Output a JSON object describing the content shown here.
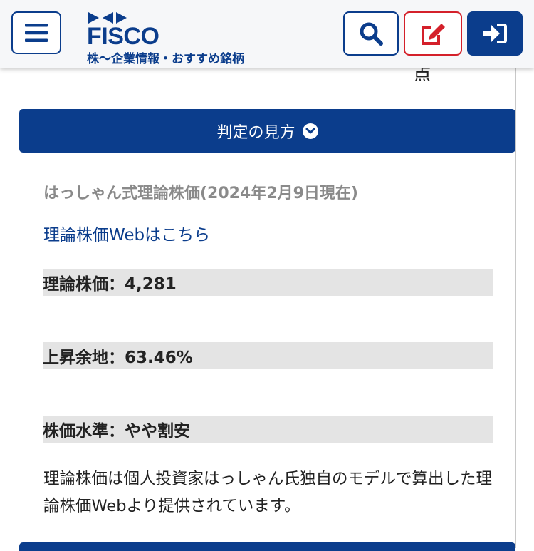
{
  "header": {
    "logo_text": "FISCO",
    "tagline": "株〜企業情報・おすすめ銘柄",
    "colors": {
      "brand": "#0b3d8c",
      "edit": "#d4202a"
    },
    "icons": [
      "menu-icon",
      "search-icon",
      "edit-icon",
      "login-icon"
    ]
  },
  "content": {
    "cut_text": "点",
    "judge_button": "判定の見方",
    "section_title": "はっしゃん式理論株価(2024年2月9日現在)",
    "link_text": "理論株価Webはこちら",
    "rows": [
      {
        "text": "理論株価：4,281"
      },
      {
        "text": "上昇余地：63.46%"
      },
      {
        "text": "株価水準：やや割安"
      }
    ],
    "note": "理論株価は個人投資家はっしゃん氏独自のモデルで算出した理論株価Webより提供されています。"
  }
}
